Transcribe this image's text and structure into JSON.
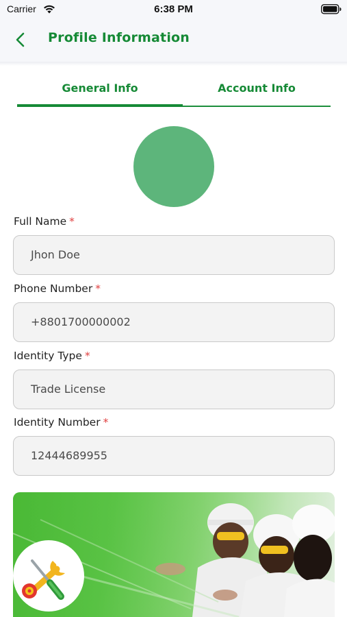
{
  "status_bar": {
    "carrier": "Carrier",
    "time": "6:38 PM"
  },
  "header": {
    "title": "Profile Information",
    "back_icon": "chevron-left-icon"
  },
  "tabs": [
    {
      "label": "General Info",
      "active": true
    },
    {
      "label": "Account Info",
      "active": false
    }
  ],
  "form": {
    "required_mark": "*",
    "fields": [
      {
        "label": "Full Name",
        "value": "Jhon Doe"
      },
      {
        "label": "Phone Number",
        "value": "+8801700000002"
      },
      {
        "label": "Identity Type",
        "value": "Trade License"
      },
      {
        "label": "Identity Number",
        "value": "12444689955"
      }
    ]
  },
  "colors": {
    "brand_green": "#168a36",
    "avatar": "#5db57b",
    "required": "#e04040"
  },
  "banner": {
    "logo_icon": "tools-icon"
  }
}
